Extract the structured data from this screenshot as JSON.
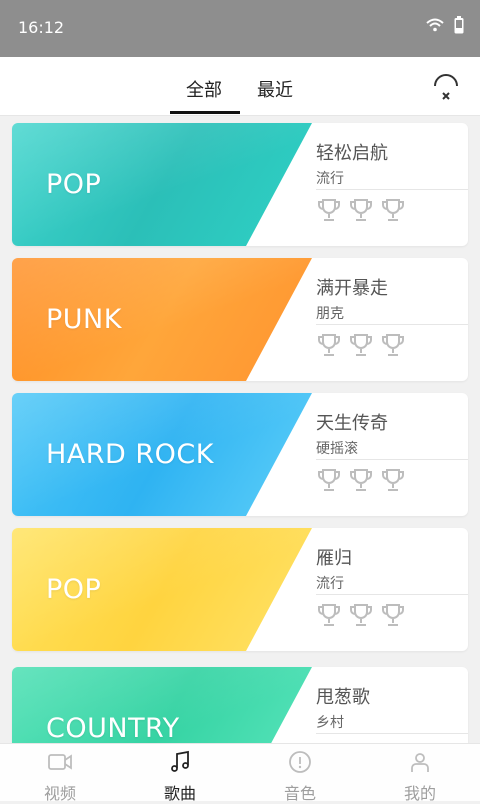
{
  "status": {
    "time": "16:12"
  },
  "tabs": [
    {
      "label": "全部"
    },
    {
      "label": "最近"
    }
  ],
  "songs": [
    {
      "genre_art": "POP",
      "title": "轻松启航",
      "category": "流行"
    },
    {
      "genre_art": "PUNK",
      "title": "满开暴走",
      "category": "朋克"
    },
    {
      "genre_art": "HARD ROCK",
      "title": "天生传奇",
      "category": "硬摇滚"
    },
    {
      "genre_art": "POP",
      "title": "雁归",
      "category": "流行"
    },
    {
      "genre_art": "COUNTRY",
      "title": "甩葱歌",
      "category": "乡村"
    }
  ],
  "nav": [
    {
      "label": "视频",
      "icon": "video-icon"
    },
    {
      "label": "歌曲",
      "icon": "music-note-icon"
    },
    {
      "label": "音色",
      "icon": "pick-icon"
    },
    {
      "label": "我的",
      "icon": "user-icon"
    }
  ],
  "colors": {
    "teal": "#2fc9c3",
    "orange": "#ff9a2e",
    "sky": "#3fb8f5",
    "yellow": "#ffd94d",
    "mint": "#3ed7a8"
  }
}
